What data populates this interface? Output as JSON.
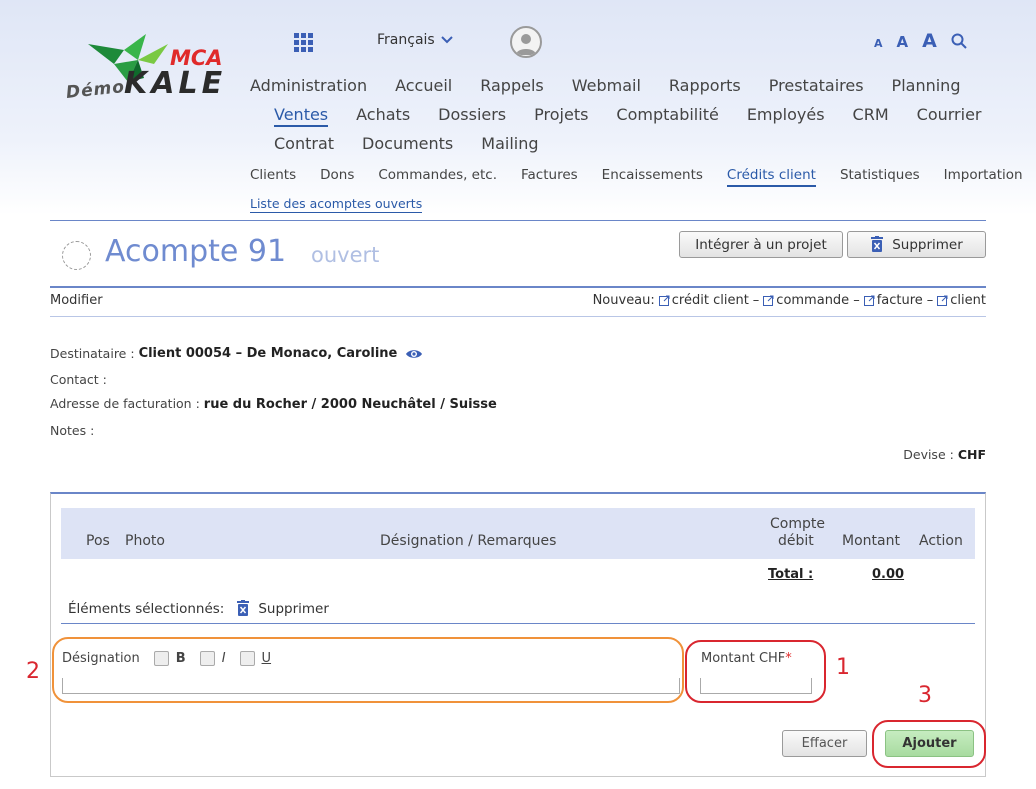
{
  "logo": {
    "demo": "Démo",
    "brand": "KALE",
    "mca": "MCA"
  },
  "header": {
    "language": "Français",
    "font_sizes": [
      "A",
      "A",
      "A"
    ]
  },
  "nav": {
    "row1": [
      "Administration",
      "Accueil",
      "Rappels",
      "Webmail",
      "Rapports",
      "Prestataires",
      "Planning"
    ],
    "row2": [
      "Ventes",
      "Achats",
      "Dossiers",
      "Projets",
      "Comptabilité",
      "Employés",
      "CRM",
      "Courrier"
    ],
    "row3": [
      "Contrat",
      "Documents",
      "Mailing"
    ],
    "active": "Ventes"
  },
  "subnav": {
    "items": [
      "Clients",
      "Dons",
      "Commandes, etc.",
      "Factures",
      "Encaissements",
      "Crédits client",
      "Statistiques",
      "Importation"
    ],
    "active": "Crédits client",
    "subitem": "Liste des acomptes ouverts"
  },
  "record": {
    "title": "Acompte 91",
    "status": "ouvert"
  },
  "actions": {
    "integrate": "Intégrer à un projet",
    "delete": "Supprimer"
  },
  "toolbar": {
    "modify": "Modifier",
    "new_label": "Nouveau:",
    "new_links": [
      "crédit client",
      "commande",
      "facture",
      "client"
    ],
    "separator": "–"
  },
  "info": {
    "recipient_label": "Destinataire :",
    "recipient_value": "Client 00054 – De Monaco, Caroline",
    "contact_label": "Contact :",
    "billing_label": "Adresse de facturation :",
    "billing_value": "rue du Rocher / 2000 Neuchâtel / Suisse",
    "notes_label": "Notes :",
    "currency_label": "Devise :",
    "currency_value": "CHF"
  },
  "table": {
    "columns": {
      "pos": "Pos",
      "photo": "Photo",
      "designation": "Désignation / Remarques",
      "account_l1": "Compte",
      "account_l2": "débit",
      "amount": "Montant",
      "action": "Action"
    },
    "total_label": "Total :",
    "total_value": "0.00",
    "selected_label": "Éléments sélectionnés:",
    "selected_delete": "Supprimer"
  },
  "form": {
    "designation_label": "Désignation",
    "format_bold": "B",
    "format_italic": "I",
    "format_underline": "U",
    "amount_label": "Montant CHF",
    "required_mark": "*",
    "clear": "Effacer",
    "add": "Ajouter"
  },
  "annotations": {
    "n1": "1",
    "n2": "2",
    "n3": "3"
  },
  "colors": {
    "accent": "#2b5aa8",
    "title": "#6f8bd0",
    "annotation_red": "#d9262f",
    "annotation_orange": "#f0923a",
    "add_button": "#b7e3b0"
  }
}
